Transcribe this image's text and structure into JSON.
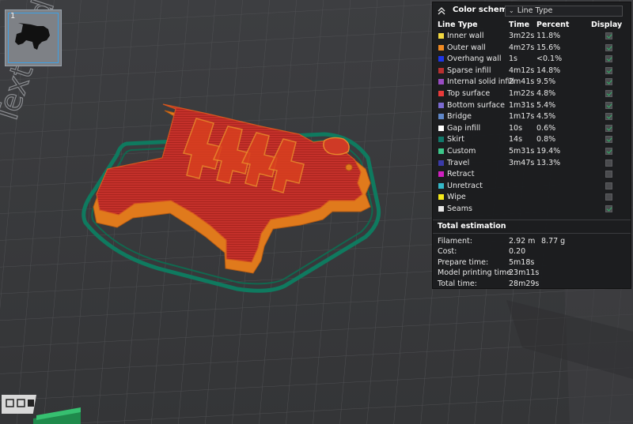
{
  "plate": {
    "number": "1",
    "bed_text": "Textured PEI Plate"
  },
  "legend": {
    "title": "Color scheme",
    "scheme_value": "Line Type",
    "headers": {
      "name": "Line Type",
      "time": "Time",
      "percent": "Percent",
      "display": "Display"
    },
    "rows": [
      {
        "name": "Inner wall",
        "time": "3m22s",
        "percent": "11.8%",
        "color": "#f2d840",
        "checked": true
      },
      {
        "name": "Outer wall",
        "time": "4m27s",
        "percent": "15.6%",
        "color": "#f08a22",
        "checked": true
      },
      {
        "name": "Overhang wall",
        "time": "1s",
        "percent": "<0.1%",
        "color": "#1e35e6",
        "checked": true
      },
      {
        "name": "Sparse infill",
        "time": "4m12s",
        "percent": "14.8%",
        "color": "#b83030",
        "checked": true
      },
      {
        "name": "Internal solid infill",
        "time": "2m41s",
        "percent": "9.5%",
        "color": "#9a4cc4",
        "checked": true
      },
      {
        "name": "Top surface",
        "time": "1m22s",
        "percent": "4.8%",
        "color": "#e83a3a",
        "checked": true
      },
      {
        "name": "Bottom surface",
        "time": "1m31s",
        "percent": "5.4%",
        "color": "#7a6ad0",
        "checked": true
      },
      {
        "name": "Bridge",
        "time": "1m17s",
        "percent": "4.5%",
        "color": "#5f87c8",
        "checked": true
      },
      {
        "name": "Gap infill",
        "time": "10s",
        "percent": "0.6%",
        "color": "#ffffff",
        "checked": true
      },
      {
        "name": "Skirt",
        "time": "14s",
        "percent": "0.8%",
        "color": "#10786a",
        "checked": true
      },
      {
        "name": "Custom",
        "time": "5m31s",
        "percent": "19.4%",
        "color": "#3cc78a",
        "checked": true
      },
      {
        "name": "Travel",
        "time": "3m47s",
        "percent": "13.3%",
        "color": "#3a3aa8",
        "checked": false
      },
      {
        "name": "Retract",
        "time": "",
        "percent": "",
        "color": "#d020c0",
        "checked": false
      },
      {
        "name": "Unretract",
        "time": "",
        "percent": "",
        "color": "#34b8c8",
        "checked": false
      },
      {
        "name": "Wipe",
        "time": "",
        "percent": "",
        "color": "#f4e81a",
        "checked": false
      },
      {
        "name": "Seams",
        "time": "",
        "percent": "",
        "color": "#e6e6e6",
        "checked": true
      }
    ]
  },
  "estimation": {
    "title": "Total estimation",
    "filament_label": "Filament:",
    "filament_length": "2.92 m",
    "filament_weight": "8.77 g",
    "cost_label": "Cost:",
    "cost_value": "0.20",
    "prepare_label": "Prepare time:",
    "prepare_value": "5m18s",
    "model_label": "Model printing time:",
    "model_value": "23m11s",
    "total_label": "Total time:",
    "total_value": "28m29s"
  },
  "colors": {
    "model_red": "#c1302a",
    "model_orange": "#e07a1c",
    "skirt_green": "#0f7a5f",
    "grid_line": "#4d4e51",
    "bed": "#3a3b3d"
  },
  "icons": {
    "collapse": "chevrons-up-icon",
    "dropdown": "chevron-down-icon",
    "plate_thumbnail": "dog-silhouette-icon"
  }
}
